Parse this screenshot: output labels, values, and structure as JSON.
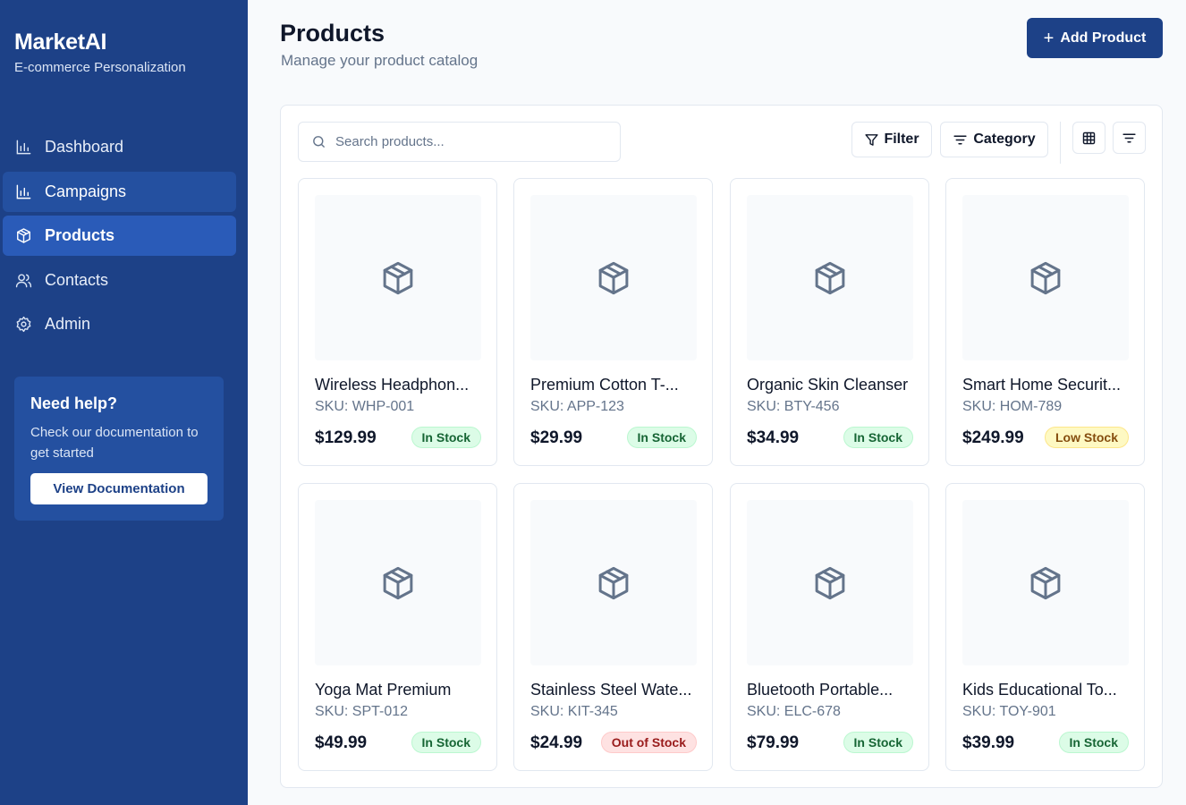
{
  "brand": {
    "title": "MarketAI",
    "subtitle": "E-commerce Personalization"
  },
  "nav": [
    {
      "label": "Dashboard",
      "icon": "bar-chart-icon"
    },
    {
      "label": "Campaigns",
      "icon": "bar-chart-icon"
    },
    {
      "label": "Products",
      "icon": "package-icon"
    },
    {
      "label": "Contacts",
      "icon": "users-icon"
    },
    {
      "label": "Admin",
      "icon": "gear-icon"
    }
  ],
  "help": {
    "title": "Need help?",
    "text": "Check our documentation to get started",
    "button": "View Documentation"
  },
  "header": {
    "title": "Products",
    "subtitle": "Manage your product catalog",
    "add_button": "Add Product",
    "add_icon": "+"
  },
  "toolbar": {
    "search_placeholder": "Search products...",
    "filter_label": "Filter",
    "category_label": "Category"
  },
  "products": [
    {
      "name": "Wireless Headphon...",
      "sku": "SKU: WHP-001",
      "price": "$129.99",
      "status": "In Stock"
    },
    {
      "name": "Premium Cotton T-...",
      "sku": "SKU: APP-123",
      "price": "$29.99",
      "status": "In Stock"
    },
    {
      "name": "Organic Skin Cleanser",
      "sku": "SKU: BTY-456",
      "price": "$34.99",
      "status": "In Stock"
    },
    {
      "name": "Smart Home Securit...",
      "sku": "SKU: HOM-789",
      "price": "$249.99",
      "status": "Low Stock"
    },
    {
      "name": "Yoga Mat Premium",
      "sku": "SKU: SPT-012",
      "price": "$49.99",
      "status": "In Stock"
    },
    {
      "name": "Stainless Steel Wate...",
      "sku": "SKU: KIT-345",
      "price": "$24.99",
      "status": "Out of Stock"
    },
    {
      "name": "Bluetooth Portable...",
      "sku": "SKU: ELC-678",
      "price": "$79.99",
      "status": "In Stock"
    },
    {
      "name": "Kids Educational To...",
      "sku": "SKU: TOY-901",
      "price": "$39.99",
      "status": "In Stock"
    }
  ],
  "colors": {
    "sidebar": "#1d4187",
    "sidebar_active": "#2a5bb8",
    "primary": "#1d4187",
    "in_stock": "#166534",
    "low_stock": "#854d0e",
    "out_of_stock": "#991b1b"
  }
}
